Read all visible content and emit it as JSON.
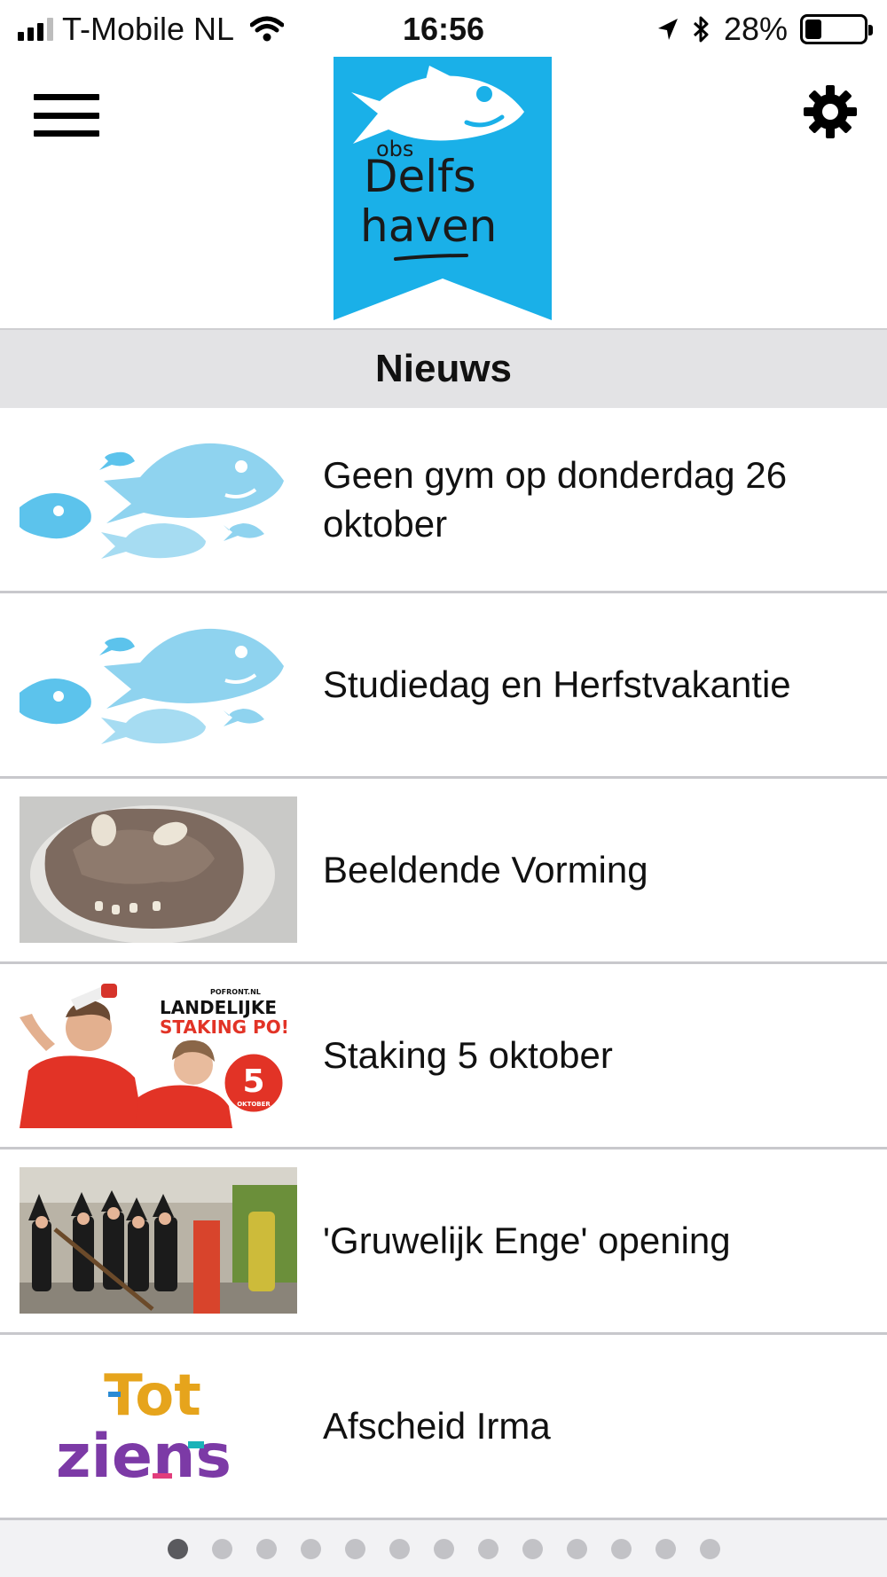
{
  "status_bar": {
    "carrier": "T-Mobile NL",
    "time": "16:56",
    "battery_percent": "28%",
    "battery_level": 0.28
  },
  "header": {
    "logo_text": {
      "top": "obs",
      "line1": "Delfs",
      "line2": "haven"
    },
    "logo_color": "#1ab0e8",
    "menu_icon": "hamburger-icon",
    "settings_icon": "gear-icon"
  },
  "section": {
    "title": "Nieuws"
  },
  "news": [
    {
      "title": "Geen gym op donderdag 26 oktober",
      "thumb": "fish-pattern"
    },
    {
      "title": "Studiedag en Herfstvakantie",
      "thumb": "fish-pattern"
    },
    {
      "title": "Beeldende Vorming",
      "thumb": "clay-sculpture-photo"
    },
    {
      "title": "Staking 5 oktober",
      "thumb": "strike-poster",
      "thumb_text": {
        "site": "POFRONT.NL",
        "line1": "LANDELIJKE",
        "line2": "STAKING PO!",
        "badge_number": "5",
        "badge_label": "OKTOBER"
      }
    },
    {
      "title": "'Gruwelijk Enge' opening",
      "thumb": "costume-group-photo"
    },
    {
      "title": "Afscheid Irma",
      "thumb": "tot-ziens-graphic",
      "thumb_text": {
        "line1": "Tot",
        "line2": "ziens"
      }
    }
  ],
  "pager": {
    "count": 13,
    "active_index": 0
  },
  "colors": {
    "fish_light": "#8fd3ef",
    "fish_blue": "#5cc3ec",
    "section_bg": "#e3e3e5",
    "divider": "#c8c8cc"
  }
}
